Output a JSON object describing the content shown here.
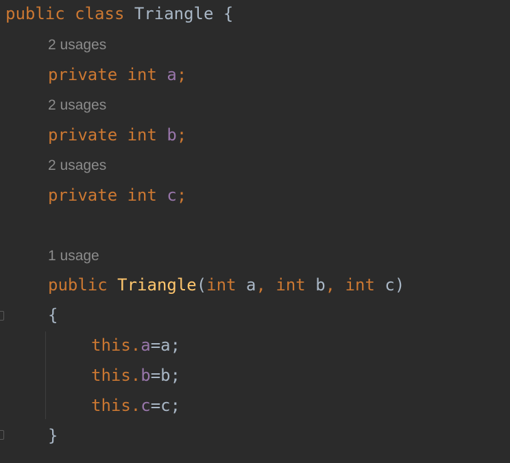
{
  "editor": {
    "class_decl": {
      "kw1": "public",
      "kw2": "class",
      "name": "Triangle",
      "brace": "{"
    },
    "fields": [
      {
        "hint": "2 usages",
        "modifier": "private",
        "type": "int",
        "name": "a",
        "semi": ";"
      },
      {
        "hint": "2 usages",
        "modifier": "private",
        "type": "int",
        "name": "b",
        "semi": ";"
      },
      {
        "hint": "2 usages",
        "modifier": "private",
        "type": "int",
        "name": "c",
        "semi": ";"
      }
    ],
    "constructor": {
      "hint": "1 usage",
      "modifier": "public",
      "name": "Triangle",
      "open_paren": "(",
      "p1_type": "int",
      "p1_name": "a",
      "comma1": ", ",
      "p2_type": "int",
      "p2_name": "b",
      "comma2": ", ",
      "p3_type": "int",
      "p3_name": "c",
      "close_paren": ")",
      "open_brace": "{",
      "close_brace": "}"
    },
    "body": [
      {
        "kw": "this",
        "dot": ".",
        "field": "a",
        "rest": "=a;"
      },
      {
        "kw": "this",
        "dot": ".",
        "field": "b",
        "rest": "=b;"
      },
      {
        "kw": "this",
        "dot": ".",
        "field": "c",
        "rest": "=c;"
      }
    ],
    "colors": {
      "background": "#2b2b2b",
      "keyword": "#cc7832",
      "field": "#9876aa",
      "method": "#ffc66d",
      "text": "#a9b7c6",
      "hint": "#8c8c8c"
    }
  }
}
